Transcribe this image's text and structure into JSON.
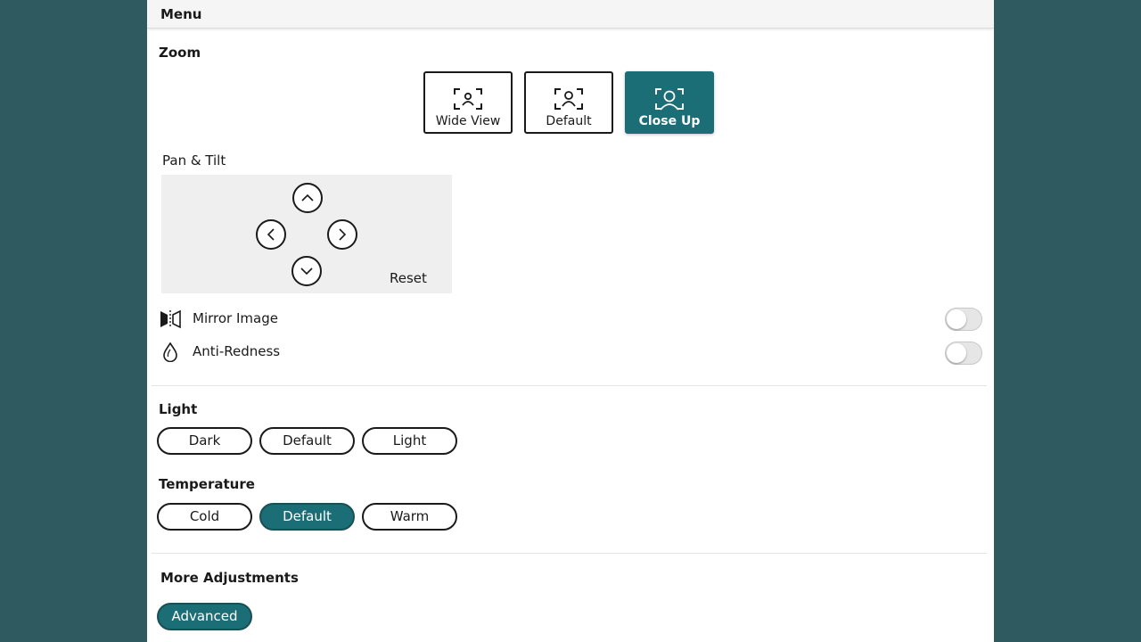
{
  "menu": {
    "title": "Menu"
  },
  "zoom": {
    "label": "Zoom",
    "options": [
      {
        "label": "Wide View",
        "icon": "wide-view-icon",
        "active": false
      },
      {
        "label": "Default",
        "icon": "default-view-icon",
        "active": false
      },
      {
        "label": "Close Up",
        "icon": "close-up-icon",
        "active": true
      }
    ]
  },
  "pan_tilt": {
    "label": "Pan & Tilt",
    "reset_label": "Reset"
  },
  "toggles": {
    "mirror": {
      "label": "Mirror Image",
      "icon": "mirror-icon",
      "on": false
    },
    "anti_redness": {
      "label": "Anti-Redness",
      "icon": "droplet-icon",
      "on": false
    }
  },
  "light": {
    "label": "Light",
    "options": [
      {
        "label": "Dark",
        "active": false
      },
      {
        "label": "Default",
        "active": false
      },
      {
        "label": "Light",
        "active": false
      }
    ]
  },
  "temperature": {
    "label": "Temperature",
    "options": [
      {
        "label": "Cold",
        "active": false
      },
      {
        "label": "Default",
        "active": true
      },
      {
        "label": "Warm",
        "active": false
      }
    ]
  },
  "more": {
    "label": "More Adjustments",
    "advanced_label": "Advanced"
  },
  "colors": {
    "accent": "#1b6e76",
    "background": "#2f5a60",
    "panel": "#ffffff"
  }
}
